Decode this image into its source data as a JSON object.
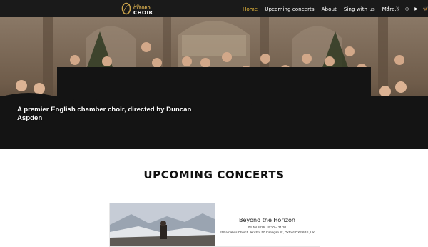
{
  "brand": {
    "line_small": "THE",
    "line_mid": "OXFORD",
    "line_big": "CHOIR",
    "gold": "#c9a24b"
  },
  "nav": {
    "items": [
      {
        "label": "Home",
        "active": true
      },
      {
        "label": "Upcoming concerts"
      },
      {
        "label": "About"
      },
      {
        "label": "Sing with us"
      },
      {
        "label": "More..."
      }
    ],
    "active_color": "#e4b53a",
    "social": [
      {
        "icon": "facebook-icon",
        "glyph": "f"
      },
      {
        "icon": "x-icon",
        "glyph": "𝕏"
      },
      {
        "icon": "instagram-icon",
        "glyph": "◎"
      },
      {
        "icon": "youtube-icon",
        "glyph": "▶"
      },
      {
        "icon": "bluesky-icon",
        "glyph": "🦋"
      }
    ]
  },
  "hero": {
    "caption": "A premier English chamber choir, directed by Duncan Aspden"
  },
  "concerts": {
    "heading": "UPCOMING CONCERTS",
    "items": [
      {
        "title": "Beyond the Horizon",
        "datetime": "04 Jul 2026, 19:30 – 21:30",
        "venue": "St Barnabas Church Jericho, 50 Cardigan St, Oxford OX2 6BS, UK"
      }
    ]
  }
}
